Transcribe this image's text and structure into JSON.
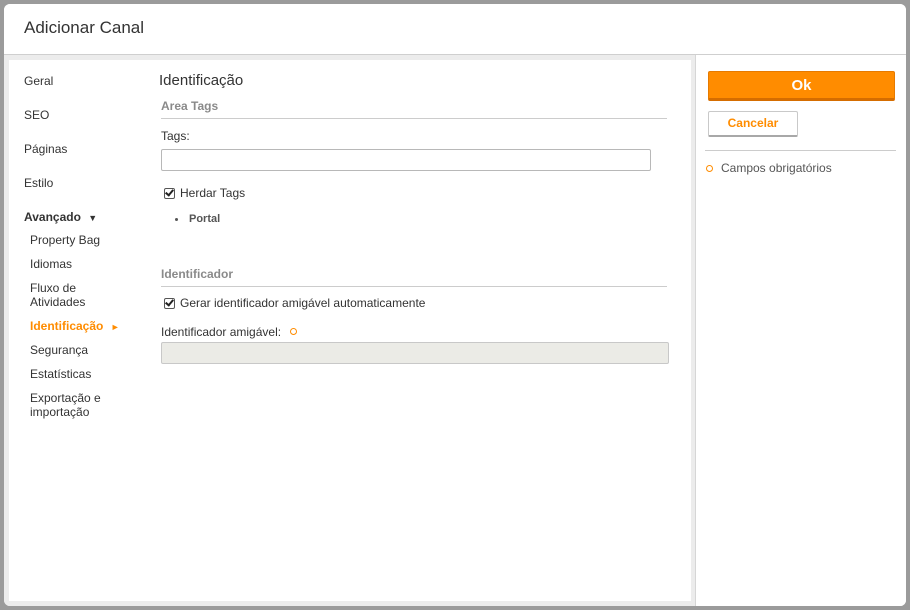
{
  "dialog": {
    "title": "Adicionar Canal"
  },
  "nav": {
    "items": [
      {
        "label": "Geral"
      },
      {
        "label": "SEO"
      },
      {
        "label": "Páginas"
      },
      {
        "label": "Estilo"
      }
    ],
    "advanced": {
      "label": "Avançado",
      "arrow": "▼",
      "items": [
        {
          "label": "Property Bag"
        },
        {
          "label": "Idiomas"
        },
        {
          "label": "Fluxo de Atividades"
        },
        {
          "label": "Identificação",
          "active": true,
          "arrow": "►"
        },
        {
          "label": "Segurança"
        },
        {
          "label": "Estatísticas"
        },
        {
          "label": "Exportação e importação"
        }
      ]
    }
  },
  "content": {
    "title": "Identificação",
    "tags_section": {
      "heading": "Area Tags",
      "tags_label": "Tags:",
      "tags_value": "",
      "inherit_label": "Herdar Tags",
      "inherit_checked": true,
      "inherited": [
        "Portal"
      ]
    },
    "identifier_section": {
      "heading": "Identificador",
      "auto_label": "Gerar identificador amigável automaticamente",
      "auto_checked": true,
      "friendly_label": "Identificador amigável:",
      "friendly_value": ""
    }
  },
  "side": {
    "ok_label": "Ok",
    "cancel_label": "Cancelar",
    "required_note": "Campos obrigatórios"
  },
  "colors": {
    "accent": "#ff8c00",
    "heading_gray": "#8a8a8a"
  },
  "icons": {
    "required": "required-icon",
    "checkbox": "checkbox-checked"
  }
}
